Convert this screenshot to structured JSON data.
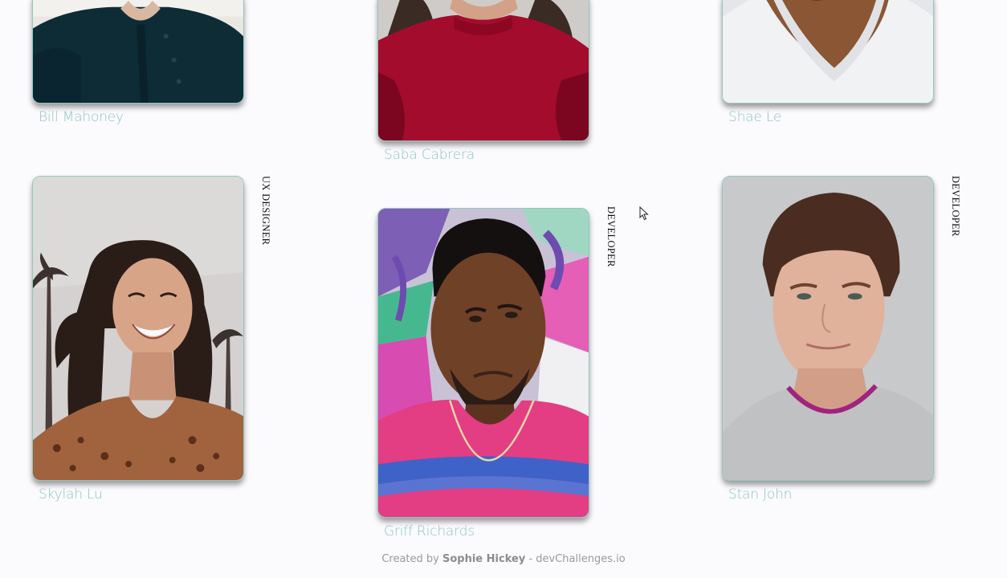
{
  "members": [
    {
      "name": "Bill Mahoney",
      "role": "",
      "photo_icon": "person-portrait-dark-polo"
    },
    {
      "name": "Saba Cabrera",
      "role": "",
      "photo_icon": "person-portrait-red-sweater"
    },
    {
      "name": "Shae Le",
      "role": "",
      "photo_icon": "person-portrait-white-tee"
    },
    {
      "name": "Skylah Lu",
      "role": "UX DESIGNER",
      "photo_icon": "person-portrait-smiling-woman"
    },
    {
      "name": "Griff Richards",
      "role": "DEVELOPER",
      "photo_icon": "person-portrait-graffiti-wall"
    },
    {
      "name": "Stan John",
      "role": "DEVELOPER",
      "photo_icon": "person-portrait-grey-sweater"
    }
  ],
  "footer": {
    "prefix": "Created by",
    "author": "Sophie Hickey",
    "suffix": "- devChallenges.io"
  },
  "colors": {
    "background": "#fbfafd",
    "accent": "#8cc7bd",
    "card_border": "#8fc9bf"
  }
}
